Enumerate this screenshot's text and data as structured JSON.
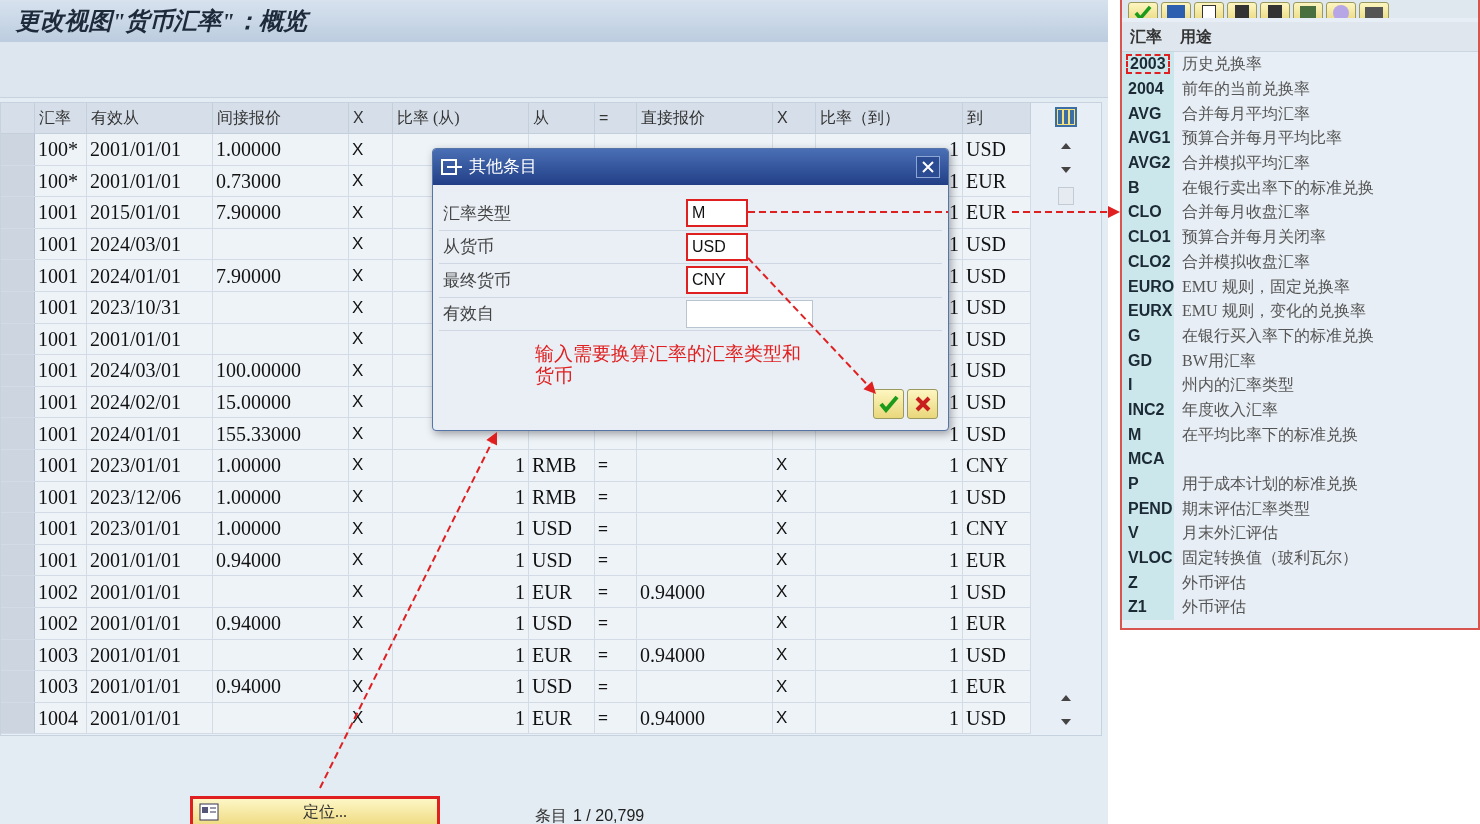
{
  "window": {
    "title": "更改视图\"货币汇率\"：概览"
  },
  "table": {
    "columns": [
      "汇率",
      "有效从",
      "间接报价",
      "X",
      "比率 (从)",
      "从",
      "=",
      "直接报价",
      "X",
      "比率（到）",
      "到"
    ],
    "rows": [
      {
        "rate": "100*",
        "valid_from": "2001/01/01",
        "indirect": "1.00000",
        "x1": "X",
        "ratio_to": "1",
        "to": "USD"
      },
      {
        "rate": "100*",
        "valid_from": "2001/01/01",
        "indirect": "0.73000",
        "x1": "X",
        "ratio_to": "1",
        "to": "EUR"
      },
      {
        "rate": "1001",
        "valid_from": "2015/01/01",
        "indirect": "7.90000",
        "x1": "X",
        "ratio_to": "1",
        "to": "EUR"
      },
      {
        "rate": "1001",
        "valid_from": "2024/03/01",
        "x1": "X",
        "ratio_to": "1",
        "to": "USD"
      },
      {
        "rate": "1001",
        "valid_from": "2024/01/01",
        "indirect": "7.90000",
        "x1": "X",
        "ratio_to": "1",
        "to": "USD"
      },
      {
        "rate": "1001",
        "valid_from": "2023/10/31",
        "x1": "X",
        "ratio_to": "1",
        "to": "USD"
      },
      {
        "rate": "1001",
        "valid_from": "2001/01/01",
        "x1": "X",
        "ratio_to": "1",
        "to": "USD"
      },
      {
        "rate": "1001",
        "valid_from": "2024/03/01",
        "indirect": "100.00000",
        "x1": "X",
        "ratio_to": "1",
        "to": "USD"
      },
      {
        "rate": "1001",
        "valid_from": "2024/02/01",
        "indirect": "15.00000",
        "x1": "X",
        "ratio_to": "1",
        "to": "USD"
      },
      {
        "rate": "1001",
        "valid_from": "2024/01/01",
        "indirect": "155.33000",
        "x1": "X",
        "ratio_to": "1",
        "to": "USD"
      },
      {
        "rate": "1001",
        "valid_from": "2023/01/01",
        "indirect": "1.00000",
        "x1": "X",
        "ratio_from": "1",
        "from": "RMB",
        "eq": "=",
        "x2": "X",
        "ratio_to": "1",
        "to": "CNY"
      },
      {
        "rate": "1001",
        "valid_from": "2023/12/06",
        "indirect": "1.00000",
        "x1": "X",
        "ratio_from": "1",
        "from": "RMB",
        "eq": "=",
        "x2": "X",
        "ratio_to": "1",
        "to": "USD"
      },
      {
        "rate": "1001",
        "valid_from": "2023/01/01",
        "indirect": "1.00000",
        "x1": "X",
        "ratio_from": "1",
        "from": "USD",
        "eq": "=",
        "x2": "X",
        "ratio_to": "1",
        "to": "CNY"
      },
      {
        "rate": "1001",
        "valid_from": "2001/01/01",
        "indirect": "0.94000",
        "x1": "X",
        "ratio_from": "1",
        "from": "USD",
        "eq": "=",
        "x2": "X",
        "ratio_to": "1",
        "to": "EUR"
      },
      {
        "rate": "1002",
        "valid_from": "2001/01/01",
        "x1": "X",
        "ratio_from": "1",
        "from": "EUR",
        "eq": "=",
        "direct": "0.94000",
        "x2": "X",
        "ratio_to": "1",
        "to": "USD"
      },
      {
        "rate": "1002",
        "valid_from": "2001/01/01",
        "indirect": "0.94000",
        "x1": "X",
        "ratio_from": "1",
        "from": "USD",
        "eq": "=",
        "x2": "X",
        "ratio_to": "1",
        "to": "EUR"
      },
      {
        "rate": "1003",
        "valid_from": "2001/01/01",
        "x1": "X",
        "ratio_from": "1",
        "from": "EUR",
        "eq": "=",
        "direct": "0.94000",
        "x2": "X",
        "ratio_to": "1",
        "to": "USD"
      },
      {
        "rate": "1003",
        "valid_from": "2001/01/01",
        "indirect": "0.94000",
        "x1": "X",
        "ratio_from": "1",
        "from": "USD",
        "eq": "=",
        "x2": "X",
        "ratio_to": "1",
        "to": "EUR"
      },
      {
        "rate": "1004",
        "valid_from": "2001/01/01",
        "x1": "X",
        "ratio_from": "1",
        "from": "EUR",
        "eq": "=",
        "direct": "0.94000",
        "x2": "X",
        "ratio_to": "1",
        "to": "USD"
      }
    ]
  },
  "dialog": {
    "title": "其他条目",
    "fields": [
      {
        "label": "汇率类型",
        "value": "M",
        "highlighted": true
      },
      {
        "label": "从货币",
        "value": "USD",
        "highlighted": true
      },
      {
        "label": "最终货币",
        "value": "CNY",
        "highlighted": true
      },
      {
        "label": "有效自",
        "highlighted": false
      }
    ],
    "note": "输入需要换算汇率的汇率类型和货币"
  },
  "footer": {
    "position_button": {
      "label": "定位...",
      "highlighted": true
    },
    "entry_label": "条目",
    "entry_count": "1 / 20,799"
  },
  "help_list": {
    "columns": [
      "汇率",
      "用途"
    ],
    "rows": [
      {
        "code": "2003",
        "description": "历史兑换率",
        "highlighted": true
      },
      {
        "code": "2004",
        "description": "前年的当前兑换率",
        "highlighted": false
      },
      {
        "code": "AVG",
        "description": "合并每月平均汇率",
        "highlighted": false
      },
      {
        "code": "AVG1",
        "description": "预算合并每月平均比率",
        "highlighted": false
      },
      {
        "code": "AVG2",
        "description": "合并模拟平均汇率",
        "highlighted": false
      },
      {
        "code": "B",
        "description": "在银行卖出率下的标准兑换",
        "highlighted": false
      },
      {
        "code": "CLO",
        "description": "合并每月收盘汇率",
        "highlighted": false
      },
      {
        "code": "CLO1",
        "description": "预算合并每月关闭率",
        "highlighted": false
      },
      {
        "code": "CLO2",
        "description": "合并模拟收盘汇率",
        "highlighted": false
      },
      {
        "code": "EURO",
        "description": "EMU 规则，固定兑换率",
        "highlighted": false
      },
      {
        "code": "EURX",
        "description": "EMU 规则，变化的兑换率",
        "highlighted": false
      },
      {
        "code": "G",
        "description": "在银行买入率下的标准兑换",
        "highlighted": false
      },
      {
        "code": "GD",
        "description": "BW用汇率",
        "highlighted": false
      },
      {
        "code": "I",
        "description": "州内的汇率类型",
        "highlighted": false
      },
      {
        "code": "INC2",
        "description": "年度收入汇率",
        "highlighted": false
      },
      {
        "code": "M",
        "description": "在平均比率下的标准兑换",
        "highlighted": false
      },
      {
        "code": "MCA",
        "highlighted": false
      },
      {
        "code": "P",
        "description": "用于成本计划的标准兑换",
        "highlighted": false
      },
      {
        "code": "PEND",
        "description": "期末评估汇率类型",
        "highlighted": false
      },
      {
        "code": "V",
        "description": "月末外汇评估",
        "highlighted": false
      },
      {
        "code": "VLOC",
        "description": "固定转换值（玻利瓦尔）",
        "highlighted": false
      },
      {
        "code": "Z",
        "description": "外币评估",
        "highlighted": false
      },
      {
        "code": "Z1",
        "description": "外币评估",
        "highlighted": false
      }
    ]
  }
}
